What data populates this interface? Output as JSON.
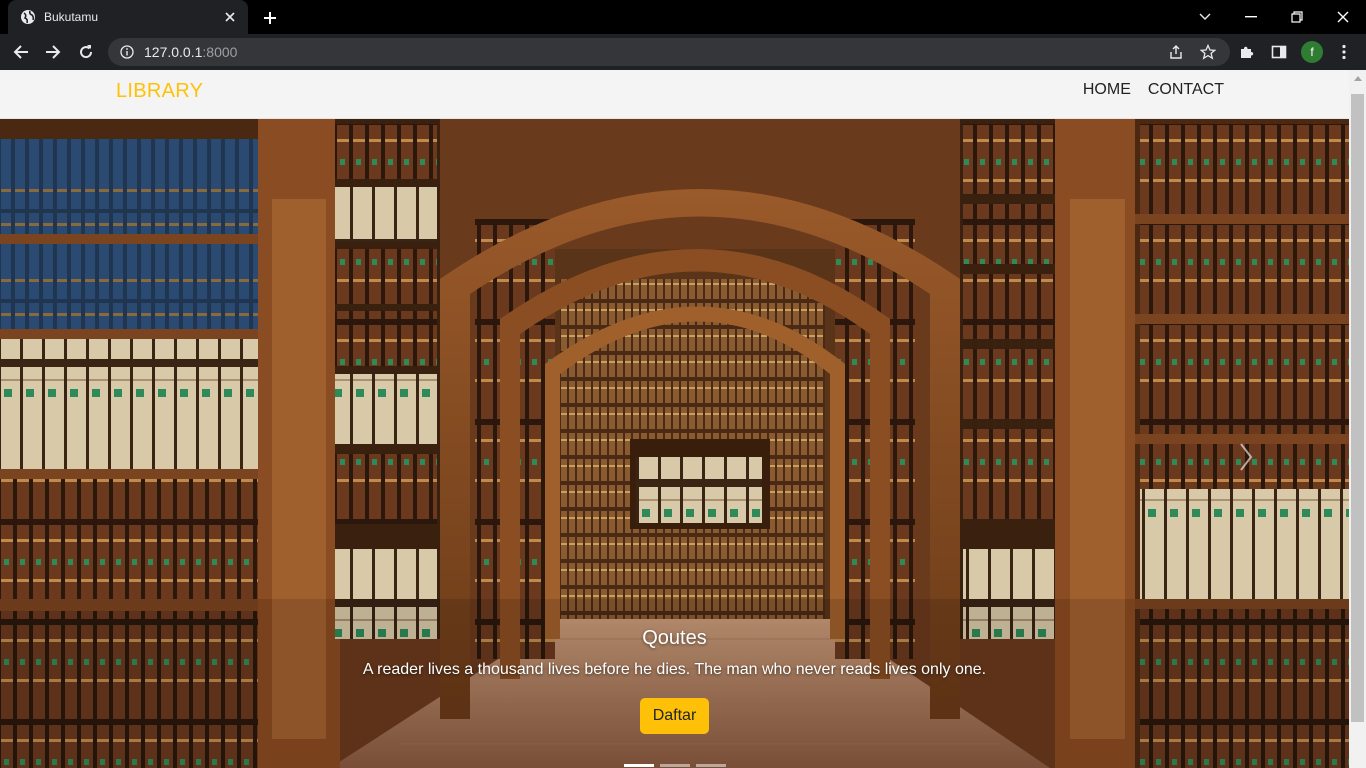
{
  "browser": {
    "tab": {
      "title": "Bukutamu",
      "favicon": "globe-icon"
    },
    "address": {
      "host": "127.0.0.1",
      "port": ":8000"
    },
    "profile_initial": "f",
    "icons": {
      "back": "arrow-left-icon",
      "forward": "arrow-right-icon",
      "reload": "reload-icon",
      "site_info": "info-icon",
      "share": "share-icon",
      "bookmark": "star-icon",
      "extensions": "puzzle-icon",
      "side_panel": "side-panel-icon",
      "menu": "kebab-menu-icon"
    }
  },
  "page": {
    "brand": "LIBRARY",
    "nav": [
      {
        "label": "HOME"
      },
      {
        "label": "CONTACT"
      }
    ],
    "hero": {
      "caption_title": "Qoutes",
      "caption_text": "A reader lives a thousand lives before he dies. The man who never reads lives only one.",
      "button_label": "Daftar",
      "slide_count": 3,
      "active_slide": 1
    }
  },
  "colors": {
    "brand": "#ffc107",
    "button": "#ffc107",
    "navbar_bg": "#f4f4f4",
    "chrome_bg": "#202124",
    "tabstrip_bg": "#000000"
  }
}
